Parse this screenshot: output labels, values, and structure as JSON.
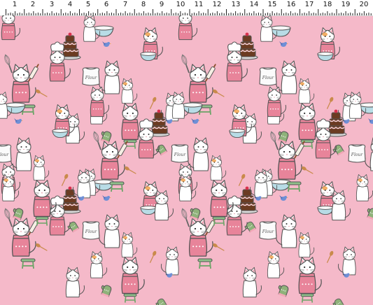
{
  "ruler": {
    "ticks": [
      "1",
      "2",
      "3",
      "4",
      "5",
      "6",
      "7",
      "8",
      "9",
      "10",
      "11",
      "12",
      "13",
      "14",
      "15",
      "16",
      "17",
      "18",
      "19",
      "20"
    ]
  },
  "fabric": {
    "background": "#f5b9c9",
    "motifs": [
      "cat-chef-icon",
      "cake-icon",
      "flour-sack-icon",
      "whisk-icon",
      "rolling-pin-icon",
      "bird-icon",
      "oven-mitt-icon",
      "mixing-bowl-icon"
    ],
    "flour_label": "Flour",
    "colors": {
      "cat": "#ffffff",
      "outline": "#555555",
      "apron": "#e8849a",
      "cake": "#6b3b22",
      "bowl": "#b8dce6",
      "stool": "#8fc08a",
      "bird": "#6f8fd6",
      "mitt": "#8fb27a",
      "spoon": "#c98a4b",
      "orange": "#f0a04b"
    }
  }
}
